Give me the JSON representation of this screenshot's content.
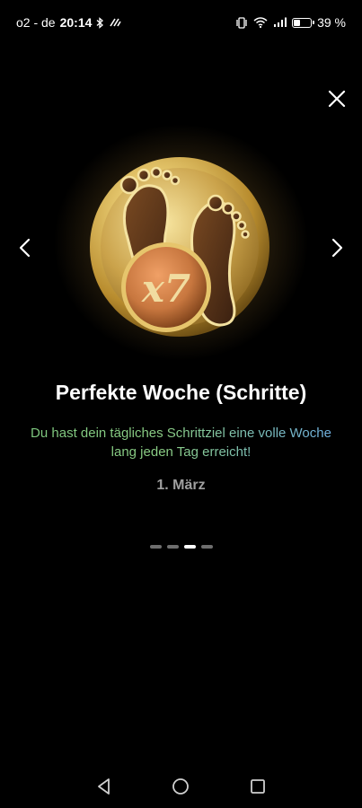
{
  "status_bar": {
    "carrier": "o2 - de",
    "time": "20:14",
    "battery": "39 %",
    "battery_level": 0.39,
    "icons": [
      "bluetooth-icon",
      "nfc-icon",
      "vibrate-icon",
      "wifi-icon",
      "signal-icon",
      "battery-icon"
    ]
  },
  "achievement": {
    "title": "Perfekte Woche (Schritte)",
    "description": "Du hast dein tägliches Schrittziel eine volle Woche lang jeden Tag erreicht!",
    "date": "1. März",
    "badge_text": "x7",
    "badge_icon": "footprints-medal-icon"
  },
  "pager": {
    "total": 4,
    "active_index": 2
  },
  "colors": {
    "background": "#000000",
    "gold": "#d8b659",
    "bronze": "#c8773f",
    "description_green": "#7ec97f",
    "description_blue": "#6fb0e6",
    "date_gray": "#a0a0a0"
  },
  "navbar": {
    "icons": [
      "back-icon",
      "home-icon",
      "recents-icon"
    ]
  }
}
